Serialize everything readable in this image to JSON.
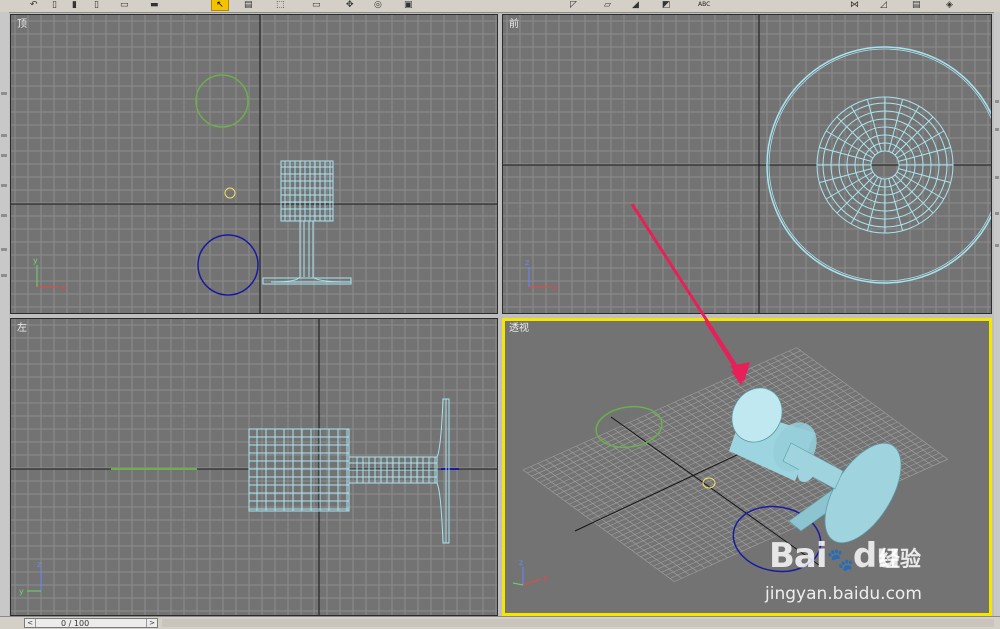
{
  "toolbar": {
    "abc_label": "ABC",
    "icons": [
      "undo-icon",
      "redo-icon",
      "select-link-icon",
      "select-cursor-icon",
      "select-by-name-icon",
      "rectangular-selection-icon",
      "move-icon",
      "rotate-icon",
      "scale-icon",
      "mirror-icon",
      "align-icon",
      "text-tool-icon",
      "snap-icon",
      "render-icon"
    ]
  },
  "viewports": {
    "top": {
      "label": "顶"
    },
    "front": {
      "label": "前"
    },
    "left": {
      "label": "左"
    },
    "perspective": {
      "label": "透视"
    }
  },
  "axis_labels": {
    "x": "x",
    "y": "y",
    "z": "z"
  },
  "colors": {
    "viewport_bg": "#737373",
    "grid": "#8c8c8c",
    "axis_line": "#151515",
    "mesh": "#a8e4f0",
    "green_circle": "#6ab04c",
    "blue_circle": "#1a1aa0",
    "yellow_marker": "#f0e060",
    "active_border": "#f5e600",
    "arrow": "#e8205a"
  },
  "timeline": {
    "current": "0",
    "separator": "/",
    "total": "100",
    "prev_icon": "<",
    "next_icon": ">"
  },
  "watermark": {
    "brand": "Bai",
    "brand_suffix": "du",
    "cn": "经验",
    "url": "jingyan.baidu.com"
  }
}
